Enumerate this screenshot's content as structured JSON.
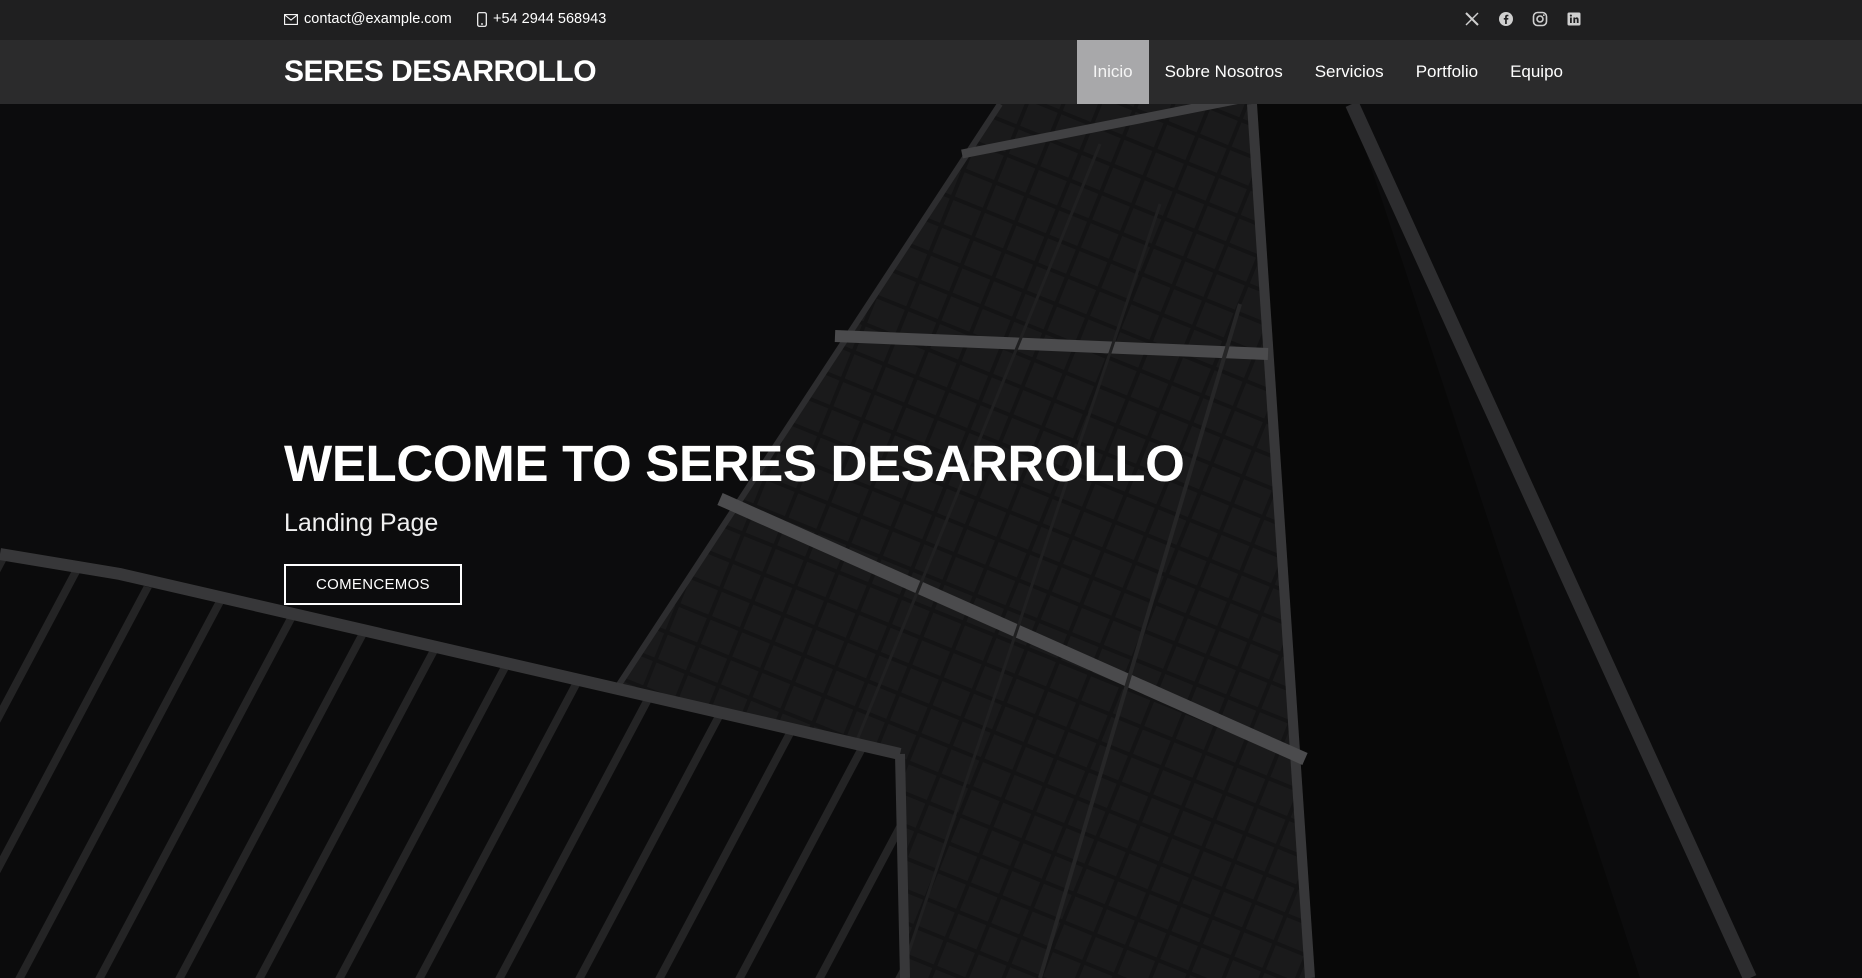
{
  "topbar": {
    "email": "contact@example.com",
    "phone": "+54 2944 568943",
    "email_icon": "envelope-icon",
    "phone_icon": "phone-icon",
    "socials": [
      "x-twitter-icon",
      "facebook-icon",
      "instagram-icon",
      "linkedin-icon"
    ]
  },
  "nav": {
    "brand": "SERES DESARROLLO",
    "items": [
      "Inicio",
      "Sobre Nosotros",
      "Servicios",
      "Portfolio",
      "Equipo"
    ],
    "active": "Inicio"
  },
  "hero": {
    "title": "WELCOME TO SERES DESARROLLO",
    "subtitle": "Landing Page",
    "cta": "COMENCEMOS"
  },
  "colors": {
    "topbar_bg": "#1f1f20",
    "navbar_bg": "#2b2b2c",
    "active_item_bg": "#a8a8aa",
    "hero_bg": "#141415"
  }
}
